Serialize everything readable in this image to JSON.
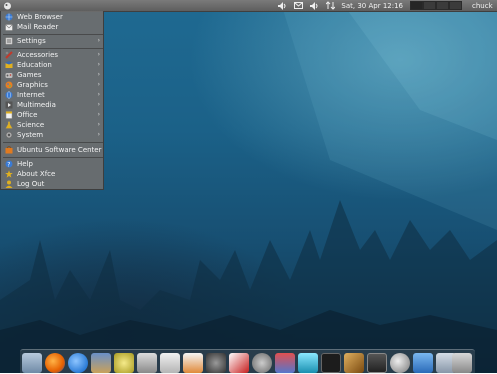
{
  "top_panel": {
    "tray_icons": [
      "volume-icon",
      "mail-icon",
      "volume-icon",
      "network-icon"
    ],
    "clock": "Sat, 30 Apr  12:16",
    "workspaces": 4,
    "user": "chuck"
  },
  "app_menu": {
    "items": [
      {
        "label": "Web Browser",
        "icon": "globe-icon",
        "color": "#3a7bd5",
        "submenu": false
      },
      {
        "label": "Mail Reader",
        "icon": "mail-icon",
        "color": "#dddddd",
        "submenu": false
      },
      {
        "label": "Settings",
        "icon": "settings-icon",
        "color": "#cfcfcf",
        "submenu": true
      },
      {
        "label": "Accessories",
        "icon": "accessories-icon",
        "color": "#c0392b",
        "submenu": true
      },
      {
        "label": "Education",
        "icon": "education-icon",
        "color": "#e0b020",
        "submenu": true
      },
      {
        "label": "Games",
        "icon": "games-icon",
        "color": "#bbbbbb",
        "submenu": true
      },
      {
        "label": "Graphics",
        "icon": "graphics-icon",
        "color": "#e67e22",
        "submenu": true
      },
      {
        "label": "Internet",
        "icon": "internet-icon",
        "color": "#3a7bd5",
        "submenu": true
      },
      {
        "label": "Multimedia",
        "icon": "multimedia-icon",
        "color": "#555555",
        "submenu": true
      },
      {
        "label": "Office",
        "icon": "office-icon",
        "color": "#e0b020",
        "submenu": true
      },
      {
        "label": "Science",
        "icon": "science-icon",
        "color": "#e0b020",
        "submenu": true
      },
      {
        "label": "System",
        "icon": "system-icon",
        "color": "#aaaaaa",
        "submenu": true
      },
      {
        "label": "Ubuntu Software Center",
        "icon": "software-center-icon",
        "color": "#e07a1f",
        "submenu": false
      },
      {
        "label": "Help",
        "icon": "help-icon",
        "color": "#3a7bd5",
        "submenu": false
      },
      {
        "label": "About Xfce",
        "icon": "about-icon",
        "color": "#e0b020",
        "submenu": false
      },
      {
        "label": "Log Out",
        "icon": "logout-icon",
        "color": "#e0b020",
        "submenu": false
      }
    ]
  },
  "dock": {
    "items": [
      {
        "name": "file-manager-icon",
        "color": "#8aa6c4"
      },
      {
        "name": "firefox-icon",
        "color": "#e66000"
      },
      {
        "name": "thunderbird-icon",
        "color": "#2b7bd6"
      },
      {
        "name": "software-center-icon",
        "color": "#c9a15a"
      },
      {
        "name": "media-player-icon",
        "color": "#e0d04a"
      },
      {
        "name": "text-editor-icon",
        "color": "#b8b8b8"
      },
      {
        "name": "notes-icon",
        "color": "#d8d8d8"
      },
      {
        "name": "document-viewer-icon",
        "color": "#e08a3a"
      },
      {
        "name": "webcam-icon",
        "color": "#666666"
      },
      {
        "name": "cards-game-icon",
        "color": "#d8d8d8"
      },
      {
        "name": "settings-icon",
        "color": "#9a9a9a"
      },
      {
        "name": "network-icon",
        "color": "#c0392b"
      },
      {
        "name": "gem-game-icon",
        "color": "#2ac0e0"
      },
      {
        "name": "terminal-icon",
        "color": "#222222"
      },
      {
        "name": "game-icon",
        "color": "#b07b2a"
      },
      {
        "name": "console-icon",
        "color": "#444444"
      },
      {
        "name": "search-icon",
        "color": "#bbbbbb"
      },
      {
        "name": "download-icon",
        "color": "#3a8ad5"
      },
      {
        "name": "folder-icon",
        "color": "#9aa8b8"
      },
      {
        "name": "trash-icon",
        "color": "#aaaaaa"
      }
    ]
  }
}
